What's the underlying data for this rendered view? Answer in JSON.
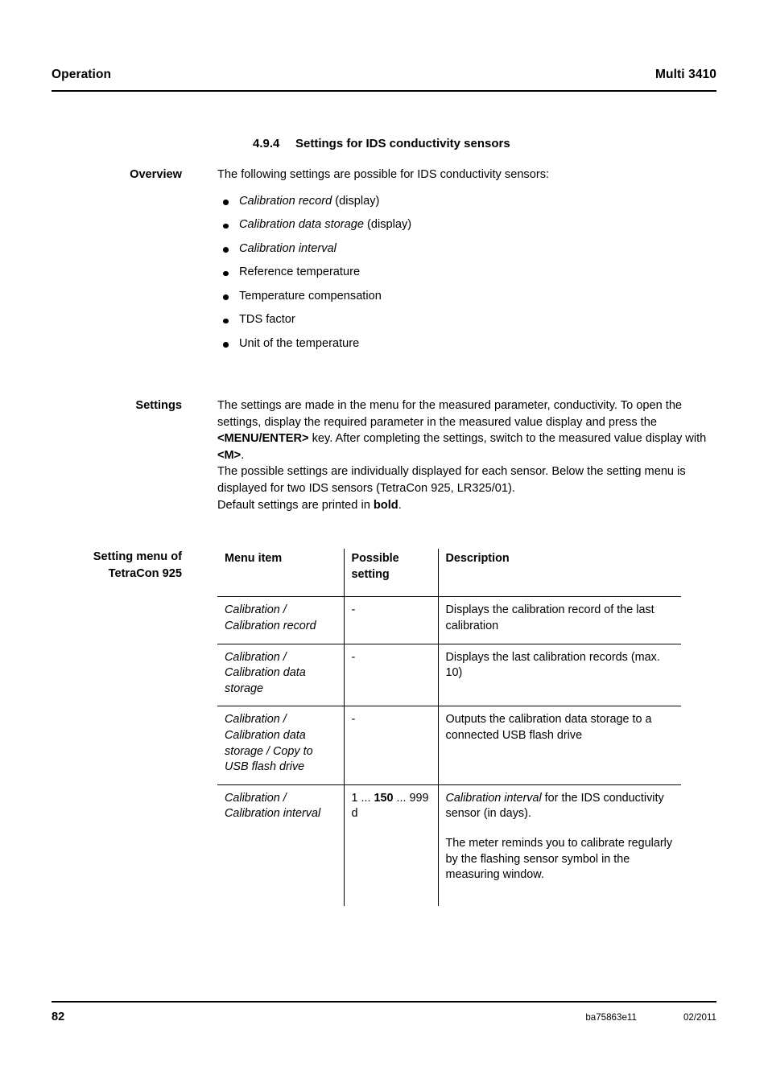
{
  "header": {
    "left": "Operation",
    "right": "Multi 3410"
  },
  "section": {
    "number": "4.9.4",
    "title": "Settings for IDS conductivity sensors"
  },
  "overview": {
    "label": "Overview",
    "intro": "The following settings are possible for IDS conductivity sensors:",
    "bullets": [
      {
        "italic": "Calibration record",
        "plain": " (display)"
      },
      {
        "italic": "Calibration data storage",
        "plain": " (display)"
      },
      {
        "italic": "Calibration interval",
        "plain": ""
      },
      {
        "italic": "",
        "plain": "Reference temperature"
      },
      {
        "italic": "",
        "plain": "Temperature compensation"
      },
      {
        "italic": "",
        "plain": "TDS factor"
      },
      {
        "italic": "",
        "plain": "Unit of the temperature"
      }
    ]
  },
  "settings": {
    "label": "Settings",
    "p1_a": "The settings are made in the menu for the measured parameter, conductivity. To open the settings, display the required parameter in the measured value display and press the ",
    "p1_key1": "<MENU/ENTER>",
    "p1_b": " key. After completing the settings, switch to the measured value display with ",
    "p1_key2": "<M>",
    "p1_c": ".",
    "p2": "The possible settings are individually displayed for each sensor. Below the setting menu is displayed for two IDS sensors (TetraCon 925, LR325/01).",
    "p3_a": "Default settings are printed in ",
    "p3_bold": "bold",
    "p3_b": "."
  },
  "table": {
    "label_line1": "Setting menu of",
    "label_line2": "TetraCon 925",
    "columns": [
      "Menu item",
      "Possible setting",
      "Description"
    ],
    "rows": [
      {
        "menu_item": "Calibration / Calibration record",
        "possible_setting": "-",
        "description": "Displays the calibration record of the last calibration"
      },
      {
        "menu_item": "Calibration / Calibration data storage",
        "possible_setting": "-",
        "description": "Displays the last calibration records (max. 10)"
      },
      {
        "menu_item": "Calibration / Calibration data storage / Copy to USB flash drive",
        "possible_setting": "-",
        "description": "Outputs the calibration data storage to a connected USB flash drive"
      },
      {
        "menu_item": "Calibration / Calibration interval",
        "setting_prefix": "1 ... ",
        "setting_default": "150",
        "setting_suffix": " ... 999 d",
        "desc_italic": "Calibration interval",
        "desc_rest": " for the IDS conductivity sensor (in days).",
        "desc_p2": "The meter reminds you to calibrate regularly by the flashing sensor symbol in the measuring window."
      }
    ]
  },
  "footer": {
    "page_number": "82",
    "doc_id": "ba75863e11",
    "date": "02/2011"
  }
}
